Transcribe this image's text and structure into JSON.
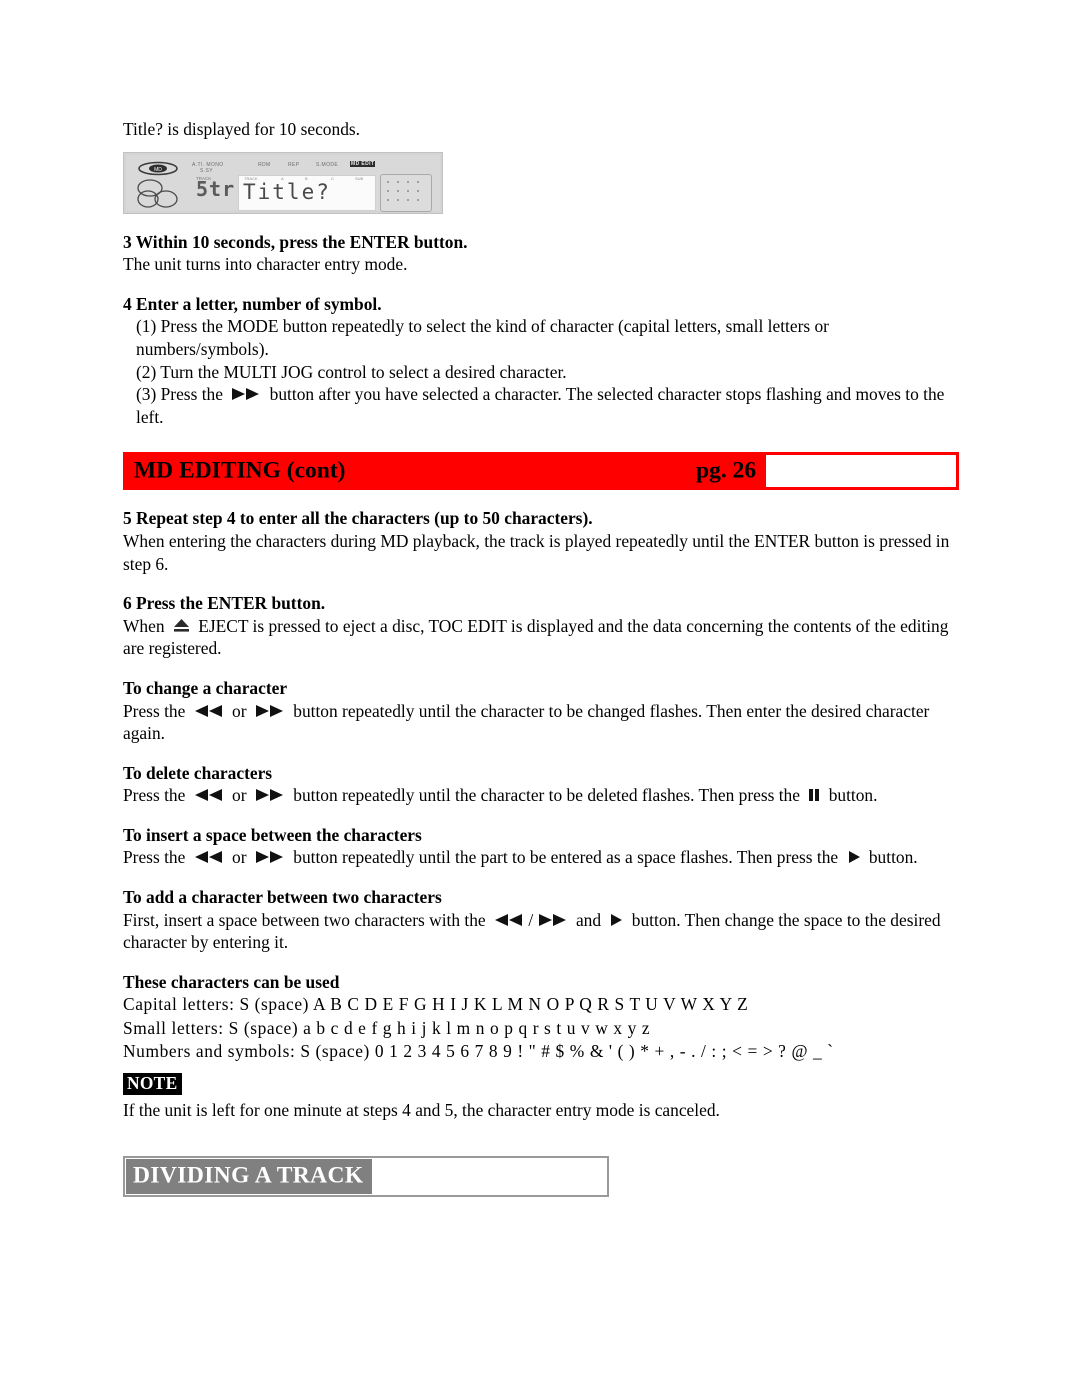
{
  "document": {
    "intro_line": "Title? is displayed for 10 seconds.",
    "display_panel": {
      "name": "md-lcd-display",
      "logo_text": "MD",
      "indicator_labels": [
        "A.TI. MONO",
        "S.SY",
        "RDM",
        "REP",
        "S.MODE",
        "MD EDIT"
      ],
      "track_number": "5tr",
      "track_caption": "TRACK",
      "display_text": "Title?",
      "window_mini_labels": [
        "TRACK",
        "A",
        "B",
        "C",
        "SUB"
      ]
    },
    "steps": [
      {
        "heading": "3 Within 10 seconds, press the ENTER button.",
        "body": "The unit turns into character entry mode."
      },
      {
        "heading": "4 Enter a letter, number of symbol.",
        "sub_items": [
          "(1) Press the MODE button repeatedly to select the kind of character (capital letters, small letters or numbers/symbols).",
          "(2) Turn the MULTI JOG control to select a desired character.",
          "(3) Press the",
          "button after you have selected a character.  The selected character stops flashing and moves to the left."
        ]
      }
    ],
    "banner": {
      "title": "MD EDITING (cont)",
      "page_label": "pg. 26",
      "color": "#ff0000"
    },
    "step5": {
      "heading": "5 Repeat step 4 to enter all the characters (up to 50 characters).",
      "body": "When entering the characters during MD playback, the track is played repeatedly until the ENTER button is pressed in step 6."
    },
    "step6": {
      "heading": "6 Press the ENTER button.",
      "body_before": "When",
      "body_after": "EJECT is pressed to eject a disc, TOC EDIT is displayed and the data concerning the contents of the editing are registered."
    },
    "sections": [
      {
        "heading": "To change a character",
        "text_1": "Press the",
        "text_2": "or",
        "text_3": "button repeatedly until the character to be changed flashes.  Then enter the desired character again."
      },
      {
        "heading": "To delete characters",
        "text_1": "Press the",
        "text_2": "or",
        "text_3": "button repeatedly until the character to be deleted flashes.  Then press the",
        "text_4": "button."
      },
      {
        "heading": "To insert a space between the characters",
        "text_1": "Press the",
        "text_2": "or",
        "text_3": "button repeatedly until the part to be entered as a space flashes.  Then press the",
        "text_4": "button."
      },
      {
        "heading": "To add a character between two characters",
        "text_1": "First, insert a space between two characters with the",
        "text_2": "/",
        "text_3": "and",
        "text_4": "button.  Then change the space to the desired character by entering it."
      }
    ],
    "characters": {
      "heading": "These characters can be used",
      "capital_letters": "Capital letters: S (space) A B C D E F G H I J K L M N O P Q R S T U V W X Y Z",
      "small_letters": "Small letters: S (space) a b c d e f g h i j k l m n o p q r s t u v w x y z",
      "numbers_symbols": "Numbers and symbols: S (space) 0 1 2 3 4 5 6 7 8 9 ! \" # $ % & ' ( ) * + , - . / : ; < = > ? @ _ `"
    },
    "note": {
      "badge": "NOTE",
      "text": "If the unit is left for one minute at steps 4 and 5, the character entry mode is canceled."
    },
    "next_section": {
      "title": "DIVIDING A TRACK",
      "fill_color": "#808080"
    }
  }
}
